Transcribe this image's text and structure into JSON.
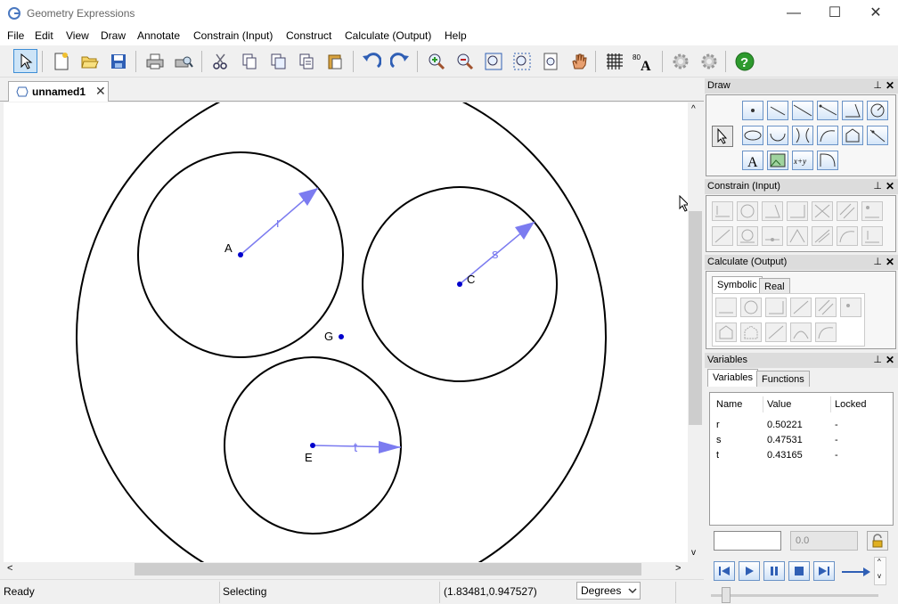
{
  "app": {
    "title": "Geometry Expressions"
  },
  "window_controls": {
    "minimize": "—",
    "maximize": "☐",
    "close": "✕"
  },
  "menu": [
    "File",
    "Edit",
    "View",
    "Draw",
    "Annotate",
    "Constrain (Input)",
    "Construct",
    "Calculate (Output)",
    "Help"
  ],
  "toolbar": {
    "icons": [
      "select-icon",
      "new-icon",
      "open-icon",
      "save-icon",
      "print-icon",
      "print-preview-icon",
      "cut-icon",
      "copy-icon",
      "copy-image-icon",
      "copy-special-icon",
      "paste-icon",
      "undo-icon",
      "redo-icon",
      "zoom-in-icon",
      "zoom-out-icon",
      "zoom-window-icon",
      "zoom-fit-icon",
      "zoom-page-icon",
      "pan-hand-icon",
      "grid-icon",
      "text-style-icon",
      "settings-gear-icon",
      "settings-gear2-icon",
      "help-icon"
    ],
    "help_glyph": "?",
    "font_glyph": "A",
    "font_number": "80"
  },
  "document": {
    "tab_label": "unnamed1",
    "tab_close": "✕"
  },
  "canvas": {
    "points": {
      "A": "A",
      "C": "C",
      "E": "E",
      "G": "G"
    },
    "radius_labels": {
      "r": "r",
      "s": "s",
      "t": "t"
    }
  },
  "scroll": {
    "up": "^",
    "down": "v",
    "left": "<",
    "right": ">"
  },
  "status": {
    "state": "Ready",
    "mode": "Selecting",
    "coords": "(1.83481,0.947527)",
    "units": "Degrees"
  },
  "panels": {
    "draw": {
      "title": "Draw",
      "text_glyph": "A",
      "expr_glyph": "x+y"
    },
    "constrain": {
      "title": "Constrain (Input)"
    },
    "calculate": {
      "title": "Calculate (Output)",
      "tabs": [
        "Symbolic",
        "Real"
      ]
    },
    "variables": {
      "title": "Variables",
      "tabs": [
        "Variables",
        "Functions"
      ],
      "columns": [
        "Name",
        "Value",
        "Locked"
      ],
      "rows": [
        {
          "name": "r",
          "value": "0.50221",
          "locked": "-"
        },
        {
          "name": "s",
          "value": "0.47531",
          "locked": "-"
        },
        {
          "name": "t",
          "value": "0.43165",
          "locked": "-"
        }
      ],
      "value_input": "",
      "step_input": "0.0"
    }
  },
  "panel_controls": {
    "pin": "⊥",
    "close": "✕"
  },
  "colors": {
    "accent": "#3e8ed6",
    "point": "#0000cc",
    "arrow": "#7b7bf0",
    "panel_header": "#dcdcdc"
  }
}
